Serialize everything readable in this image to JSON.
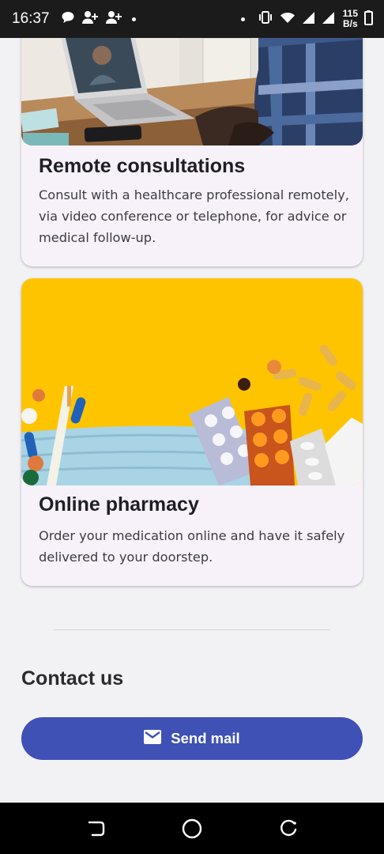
{
  "status_bar": {
    "time": "16:37",
    "net_speed_value": "115",
    "net_speed_unit": "B/s",
    "left_icons": [
      "chat-bubble-icon",
      "person-add-icon",
      "person-add-icon",
      "dot-icon"
    ],
    "right_icons": [
      "dot-icon",
      "vibrate-icon",
      "wifi-icon",
      "signal-icon",
      "signal-icon",
      "battery-icon"
    ]
  },
  "cards": [
    {
      "title": "Remote consultations",
      "description": "Consult with a healthcare professional remotely, via video conference or telephone, for advice or medical follow-up."
    },
    {
      "title": "Online pharmacy",
      "description": "Order your medication online and have it safely delivered to your doorstep."
    }
  ],
  "contact": {
    "heading": "Contact us",
    "button_label": "Send mail",
    "button_icon": "mail-icon"
  },
  "nav_bar": {
    "buttons": [
      "recents-icon",
      "home-icon",
      "back-icon"
    ]
  },
  "colors": {
    "background": "#f2f1f4",
    "card": "#f7f2fa",
    "primary": "#3f51b5",
    "pharmacy_yellow": "#ffc107"
  }
}
